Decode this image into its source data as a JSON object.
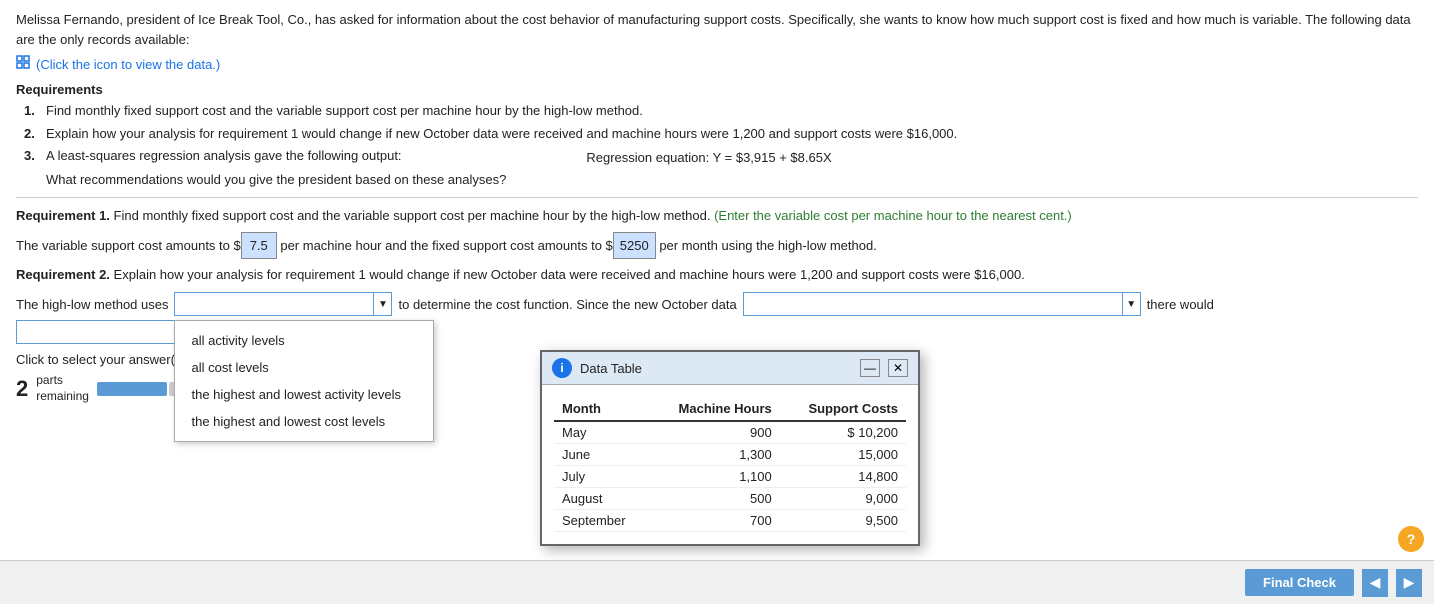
{
  "intro": {
    "text": "Melissa Fernando, president of Ice Break Tool, Co., has asked for information about the cost behavior of manufacturing support costs. Specifically, she wants to know how much support cost is fixed and how much is variable. The following data are the only records available:"
  },
  "click_link": {
    "label": "(Click the icon to view the data.)"
  },
  "requirements": {
    "title": "Requirements",
    "items": [
      {
        "num": "1.",
        "text": "Find monthly fixed support cost and the variable support cost per machine hour by the high-low method."
      },
      {
        "num": "2.",
        "text": "Explain how your analysis for requirement 1 would change if new October data were received and machine hours were 1,200 and support costs were $16,000."
      },
      {
        "num": "3.",
        "text": "A least-squares regression analysis gave the following output:"
      }
    ],
    "req3_sub": "What recommendations would you give the president based on these analyses?",
    "regression_label": "Regression equation:",
    "regression_eq": "Y = $3,915 + $8.65X"
  },
  "req1": {
    "label": "Requirement 1.",
    "main_text": "Find monthly fixed support cost and the variable support cost per machine hour by the high-low method.",
    "instruction": "(Enter the variable cost per machine hour to the nearest cent.)",
    "variable_line_pre": "The variable support cost amounts to $",
    "variable_value": "7.5",
    "variable_line_mid": " per machine hour and the fixed support cost amounts to $",
    "fixed_value": "5250",
    "variable_line_post": " per month using the high-low method."
  },
  "req2": {
    "label": "Requirement 2.",
    "text": "Explain how your analysis for requirement 1 would change if new October data were received and machine hours were 1,200 and support costs were $16,000."
  },
  "high_low_row": {
    "pre_text": "The high-low method uses",
    "dropdown1_placeholder": "",
    "mid_text": "to determine the cost function. Since the new October data",
    "dropdown2_placeholder": "",
    "post_text": "there would"
  },
  "dropdown1": {
    "options": [
      "all activity levels",
      "all cost levels",
      "the highest and lowest activity levels",
      "the highest and lowest cost levels"
    ]
  },
  "dropdown2": {
    "options": []
  },
  "click_instruction": "Click to select your answer(s), then click Check Answer.",
  "data_table_modal": {
    "title": "Data Table",
    "columns": [
      "Month",
      "Machine Hours",
      "Support Costs"
    ],
    "rows": [
      {
        "month": "May",
        "hours": "900",
        "costs": "$ 10,200"
      },
      {
        "month": "June",
        "hours": "1,300",
        "costs": "15,000"
      },
      {
        "month": "July",
        "hours": "1,100",
        "costs": "14,800"
      },
      {
        "month": "August",
        "hours": "500",
        "costs": "9,000"
      },
      {
        "month": "September",
        "hours": "700",
        "costs": "9,500"
      }
    ]
  },
  "bottom": {
    "parts_num": "2",
    "parts_label": "parts\nremaining",
    "final_check": "Final Check"
  }
}
